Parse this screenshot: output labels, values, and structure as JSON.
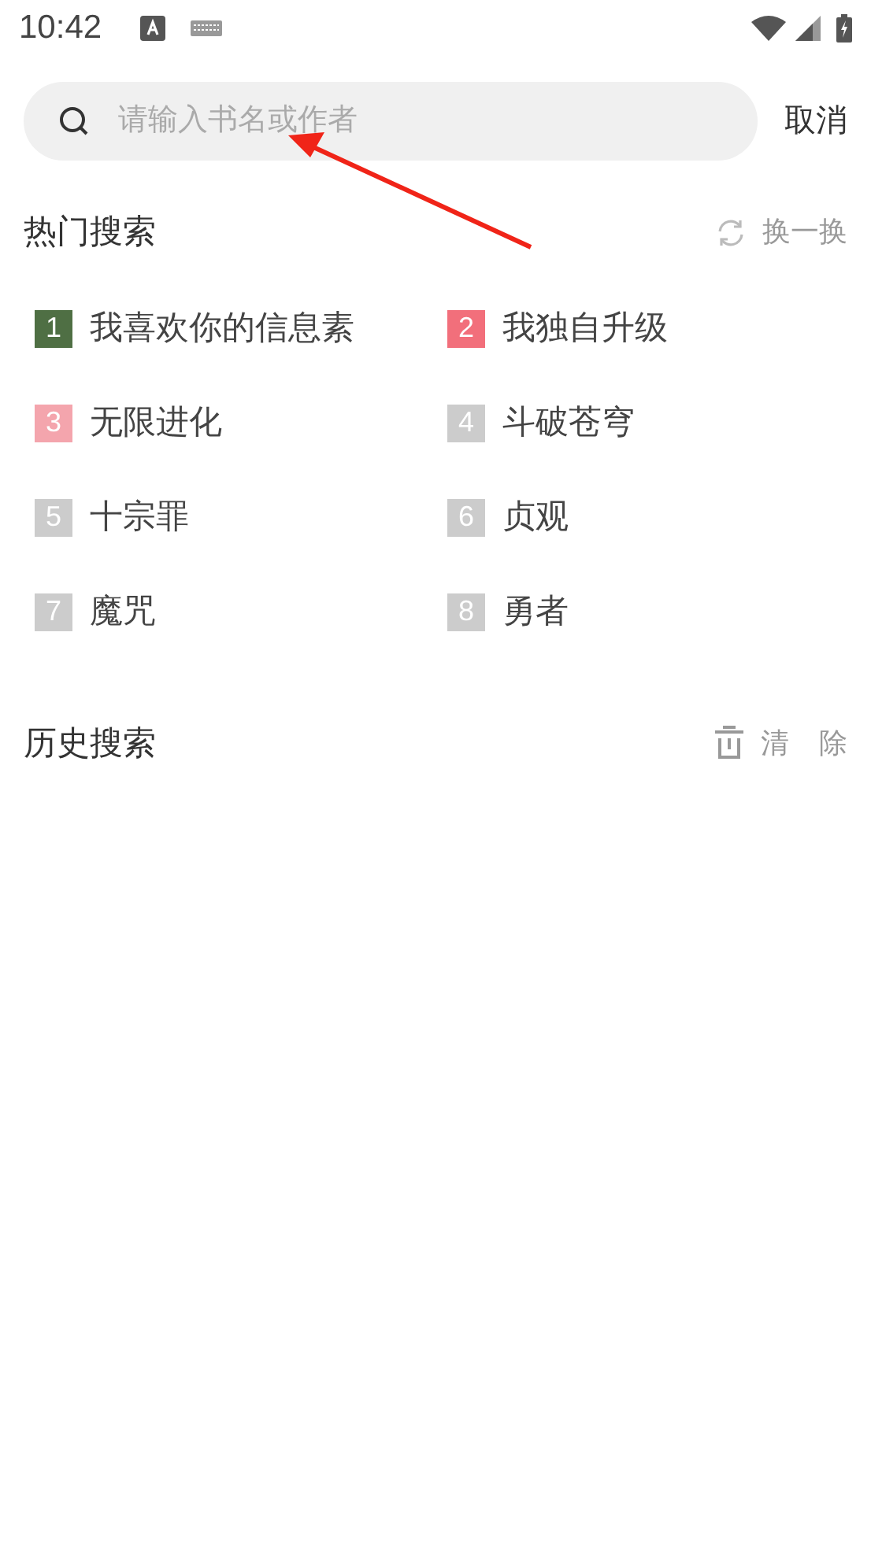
{
  "status_bar": {
    "time": "10:42"
  },
  "search": {
    "placeholder": "请输入书名或作者",
    "cancel": "取消"
  },
  "hot_search": {
    "title": "热门搜索",
    "refresh": "换一换",
    "items": [
      {
        "rank": "1",
        "title": "我喜欢你的信息素",
        "color": "#4f6f44"
      },
      {
        "rank": "2",
        "title": "我独自升级",
        "color": "#f26f7b"
      },
      {
        "rank": "3",
        "title": "无限进化",
        "color": "#f4a5ad"
      },
      {
        "rank": "4",
        "title": "斗破苍穹",
        "color": "#cccccc"
      },
      {
        "rank": "5",
        "title": "十宗罪",
        "color": "#cccccc"
      },
      {
        "rank": "6",
        "title": "贞观",
        "color": "#cccccc"
      },
      {
        "rank": "7",
        "title": "魔咒",
        "color": "#cccccc"
      },
      {
        "rank": "8",
        "title": "勇者",
        "color": "#cccccc"
      }
    ]
  },
  "history": {
    "title": "历史搜索",
    "clear": "清 除"
  }
}
